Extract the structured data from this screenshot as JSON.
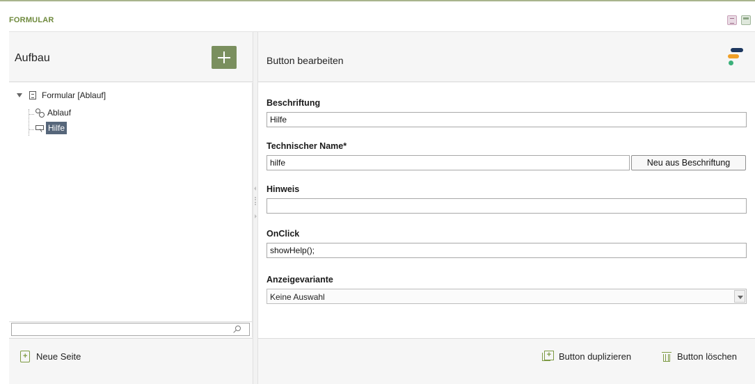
{
  "header": {
    "title": "FORMULAR",
    "icons": [
      "document-icon",
      "window-icon"
    ]
  },
  "left": {
    "title": "Aufbau",
    "tree": {
      "root_label": "Formular [Ablauf]",
      "children": [
        {
          "label": "Ablauf",
          "icon": "gear-icon"
        },
        {
          "label": "Hilfe",
          "icon": "button-icon",
          "selected": true
        }
      ]
    },
    "search": {
      "value": "",
      "placeholder": ""
    },
    "new_page_label": "Neue Seite"
  },
  "right": {
    "title": "Button bearbeiten",
    "fields": {
      "beschriftung": {
        "label": "Beschriftung",
        "value": "Hilfe"
      },
      "technischer_name": {
        "label": "Technischer Name*",
        "value": "hilfe",
        "button_label": "Neu aus Beschriftung"
      },
      "hinweis": {
        "label": "Hinweis",
        "value": ""
      },
      "onclick": {
        "label": "OnClick",
        "value": "showHelp();"
      },
      "anzeigevariante": {
        "label": "Anzeigevariante",
        "selected": "Keine Auswahl"
      }
    },
    "footer": {
      "duplicate_label": "Button duplizieren",
      "delete_label": "Button löschen"
    }
  },
  "colors": {
    "accent_green": "#7a8f5e",
    "title_green": "#6f8a3d",
    "selection": "#56667a"
  }
}
